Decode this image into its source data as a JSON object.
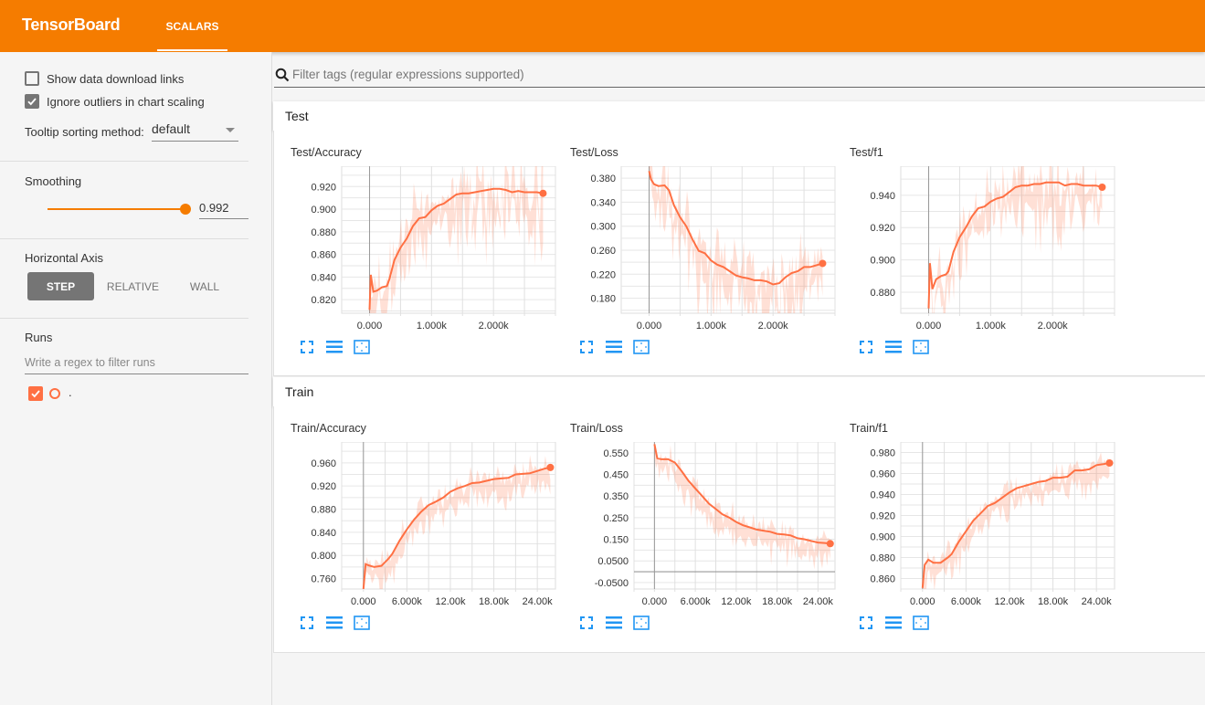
{
  "app": {
    "title": "TensorBoard",
    "tabs": [
      {
        "label": "SCALARS",
        "active": true
      }
    ],
    "accent_color": "#f57c00",
    "series_color": "#ff7043"
  },
  "sidebar": {
    "show_download_links": {
      "label": "Show data download links",
      "checked": false
    },
    "ignore_outliers": {
      "label": "Ignore outliers in chart scaling",
      "checked": true
    },
    "tooltip_sorting": {
      "label": "Tooltip sorting method:",
      "value": "default"
    },
    "smoothing": {
      "label": "Smoothing",
      "value": "0.992",
      "fraction": 0.992
    },
    "horizontal_axis": {
      "label": "Horizontal Axis",
      "options": [
        "STEP",
        "RELATIVE",
        "WALL"
      ],
      "selected": "STEP"
    },
    "runs": {
      "label": "Runs",
      "filter_placeholder": "Write a regex to filter runs",
      "items": [
        {
          "name": ".",
          "checked": true
        }
      ]
    }
  },
  "main": {
    "filter_placeholder": "Filter tags (regular expressions supported)",
    "groups": [
      {
        "name": "Test"
      },
      {
        "name": "Train"
      }
    ],
    "card_icons": [
      "fullscreen-icon",
      "toggle-log-scale-icon",
      "fit-domain-icon"
    ]
  },
  "chart_data": [
    {
      "type": "line",
      "group": "Test",
      "title": "Test/Accuracy",
      "xlim": [
        -450,
        3000
      ],
      "ylim": [
        0.808,
        0.938
      ],
      "xticks": [
        0,
        1000,
        2000
      ],
      "xtick_labels": [
        "0.000",
        "1.000k",
        "2.000k"
      ],
      "yticks": [
        0.82,
        0.84,
        0.86,
        0.88,
        0.9,
        0.92
      ],
      "ytick_labels": [
        "0.820",
        "0.840",
        "0.860",
        "0.880",
        "0.900",
        "0.920"
      ],
      "smoothed": {
        "x": [
          0,
          20,
          60,
          120,
          200,
          280,
          320,
          400,
          500,
          600,
          700,
          800,
          900,
          1000,
          1100,
          1200,
          1300,
          1400,
          1500,
          1600,
          1700,
          1800,
          1900,
          2000,
          2100,
          2200,
          2300,
          2400,
          2500,
          2600,
          2700,
          2800
        ],
        "y": [
          0.811,
          0.842,
          0.827,
          0.828,
          0.831,
          0.832,
          0.838,
          0.855,
          0.866,
          0.874,
          0.885,
          0.892,
          0.893,
          0.899,
          0.903,
          0.905,
          0.909,
          0.913,
          0.914,
          0.914,
          0.915,
          0.916,
          0.917,
          0.918,
          0.918,
          0.917,
          0.915,
          0.916,
          0.915,
          0.915,
          0.915,
          0.914
        ]
      },
      "raw_band": {
        "low": 0.808,
        "high": 0.938,
        "x_start": 0,
        "x_end": 2800
      }
    },
    {
      "type": "line",
      "group": "Test",
      "title": "Test/Loss",
      "xlim": [
        -450,
        3000
      ],
      "ylim": [
        0.155,
        0.4
      ],
      "xticks": [
        0,
        1000,
        2000
      ],
      "xtick_labels": [
        "0.000",
        "1.000k",
        "2.000k"
      ],
      "yticks": [
        0.18,
        0.22,
        0.26,
        0.3,
        0.34,
        0.38
      ],
      "ytick_labels": [
        "0.180",
        "0.220",
        "0.260",
        "0.300",
        "0.340",
        "0.380"
      ],
      "smoothed": {
        "x": [
          0,
          30,
          80,
          150,
          250,
          320,
          400,
          500,
          600,
          700,
          800,
          900,
          1000,
          1100,
          1200,
          1300,
          1400,
          1500,
          1600,
          1700,
          1800,
          1900,
          2000,
          2100,
          2200,
          2300,
          2400,
          2500,
          2600,
          2700,
          2800
        ],
        "y": [
          0.392,
          0.378,
          0.37,
          0.367,
          0.368,
          0.36,
          0.335,
          0.315,
          0.3,
          0.278,
          0.259,
          0.255,
          0.243,
          0.236,
          0.232,
          0.225,
          0.218,
          0.215,
          0.213,
          0.21,
          0.21,
          0.208,
          0.203,
          0.205,
          0.215,
          0.222,
          0.225,
          0.232,
          0.232,
          0.235,
          0.238
        ]
      },
      "raw_band": {
        "low": 0.155,
        "high": 0.4,
        "x_start": 0,
        "x_end": 2800
      }
    },
    {
      "type": "line",
      "group": "Test",
      "title": "Test/f1",
      "xlim": [
        -450,
        3000
      ],
      "ylim": [
        0.867,
        0.958
      ],
      "xticks": [
        0,
        1000,
        2000
      ],
      "xtick_labels": [
        "0.000",
        "1.000k",
        "2.000k"
      ],
      "yticks": [
        0.88,
        0.9,
        0.92,
        0.94
      ],
      "ytick_labels": [
        "0.880",
        "0.900",
        "0.920",
        "0.940"
      ],
      "smoothed": {
        "x": [
          0,
          20,
          60,
          120,
          200,
          280,
          320,
          400,
          500,
          600,
          700,
          800,
          900,
          1000,
          1100,
          1200,
          1300,
          1400,
          1500,
          1600,
          1700,
          1800,
          1900,
          2000,
          2100,
          2200,
          2300,
          2400,
          2500,
          2600,
          2700,
          2800
        ],
        "y": [
          0.87,
          0.898,
          0.882,
          0.888,
          0.89,
          0.891,
          0.893,
          0.905,
          0.914,
          0.92,
          0.927,
          0.932,
          0.933,
          0.936,
          0.938,
          0.939,
          0.942,
          0.945,
          0.946,
          0.946,
          0.947,
          0.947,
          0.948,
          0.948,
          0.948,
          0.946,
          0.947,
          0.947,
          0.946,
          0.946,
          0.946,
          0.945
        ]
      },
      "raw_band": {
        "low": 0.867,
        "high": 0.958,
        "x_start": 0,
        "x_end": 2800
      }
    },
    {
      "type": "line",
      "group": "Train",
      "title": "Train/Accuracy",
      "xlim": [
        -3000,
        26500
      ],
      "ylim": [
        0.742,
        0.996
      ],
      "xticks": [
        0,
        6000,
        12000,
        18000,
        24000
      ],
      "xtick_labels": [
        "0.000",
        "6.000k",
        "12.00k",
        "18.00k",
        "24.00k"
      ],
      "yticks": [
        0.76,
        0.8,
        0.84,
        0.88,
        0.92,
        0.96
      ],
      "ytick_labels": [
        "0.760",
        "0.800",
        "0.840",
        "0.880",
        "0.920",
        "0.960"
      ],
      "smoothed": {
        "x": [
          0,
          300,
          700,
          1500,
          2500,
          3500,
          4000,
          5000,
          6000,
          7000,
          8000,
          9000,
          10000,
          11000,
          12000,
          13000,
          14000,
          15000,
          16000,
          17000,
          18000,
          19000,
          20000,
          21000,
          22000,
          23000,
          24000,
          25000,
          25800
        ],
        "y": [
          0.742,
          0.785,
          0.783,
          0.78,
          0.782,
          0.795,
          0.803,
          0.826,
          0.845,
          0.862,
          0.876,
          0.887,
          0.893,
          0.9,
          0.91,
          0.916,
          0.92,
          0.925,
          0.926,
          0.929,
          0.932,
          0.933,
          0.934,
          0.94,
          0.941,
          0.942,
          0.946,
          0.95,
          0.952
        ]
      },
      "raw_band": {
        "low": 0.742,
        "high": 0.996,
        "x_start": 0,
        "x_end": 25800
      }
    },
    {
      "type": "line",
      "group": "Train",
      "title": "Train/Loss",
      "xlim": [
        -3000,
        26500
      ],
      "ylim": [
        -0.08,
        0.6
      ],
      "xticks": [
        0,
        6000,
        12000,
        18000,
        24000
      ],
      "xtick_labels": [
        "0.000",
        "6.000k",
        "12.00k",
        "18.00k",
        "24.00k"
      ],
      "yticks": [
        -0.05,
        0.05,
        0.15,
        0.25,
        0.35,
        0.45,
        0.55
      ],
      "ytick_labels": [
        "-0.0500",
        "0.0500",
        "0.150",
        "0.250",
        "0.350",
        "0.450",
        "0.550"
      ],
      "smoothed": {
        "x": [
          0,
          400,
          1000,
          2000,
          3000,
          4000,
          5000,
          6000,
          7000,
          8000,
          9000,
          10000,
          11000,
          12000,
          13000,
          14000,
          15000,
          16000,
          17000,
          18000,
          19000,
          20000,
          21000,
          22000,
          23000,
          24000,
          25000,
          25800
        ],
        "y": [
          0.59,
          0.525,
          0.52,
          0.52,
          0.505,
          0.465,
          0.42,
          0.385,
          0.35,
          0.315,
          0.29,
          0.265,
          0.25,
          0.23,
          0.215,
          0.205,
          0.195,
          0.19,
          0.185,
          0.175,
          0.172,
          0.168,
          0.155,
          0.15,
          0.142,
          0.135,
          0.133,
          0.13
        ]
      },
      "raw_band": {
        "low": 0.05,
        "high": 0.6,
        "x_start": 0,
        "x_end": 25800
      }
    },
    {
      "type": "line",
      "group": "Train",
      "title": "Train/f1",
      "xlim": [
        -3000,
        26500
      ],
      "ylim": [
        0.85,
        0.99
      ],
      "xticks": [
        0,
        6000,
        12000,
        18000,
        24000
      ],
      "xtick_labels": [
        "0.000",
        "6.000k",
        "12.00k",
        "18.00k",
        "24.00k"
      ],
      "yticks": [
        0.86,
        0.88,
        0.9,
        0.92,
        0.94,
        0.96,
        0.98
      ],
      "ytick_labels": [
        "0.860",
        "0.880",
        "0.900",
        "0.920",
        "0.940",
        "0.960",
        "0.980"
      ],
      "smoothed": {
        "x": [
          0,
          300,
          800,
          1500,
          2500,
          3500,
          4000,
          5000,
          6000,
          7000,
          8000,
          9000,
          10000,
          11000,
          12000,
          13000,
          14000,
          15000,
          16000,
          17000,
          18000,
          19000,
          20000,
          21000,
          22000,
          23000,
          24000,
          25000,
          25800
        ],
        "y": [
          0.851,
          0.873,
          0.878,
          0.875,
          0.875,
          0.88,
          0.883,
          0.895,
          0.905,
          0.915,
          0.922,
          0.929,
          0.932,
          0.937,
          0.942,
          0.946,
          0.948,
          0.95,
          0.952,
          0.953,
          0.956,
          0.956,
          0.957,
          0.963,
          0.963,
          0.964,
          0.968,
          0.969,
          0.97
        ]
      },
      "raw_band": {
        "low": 0.85,
        "high": 0.99,
        "x_start": 0,
        "x_end": 25800
      }
    }
  ]
}
